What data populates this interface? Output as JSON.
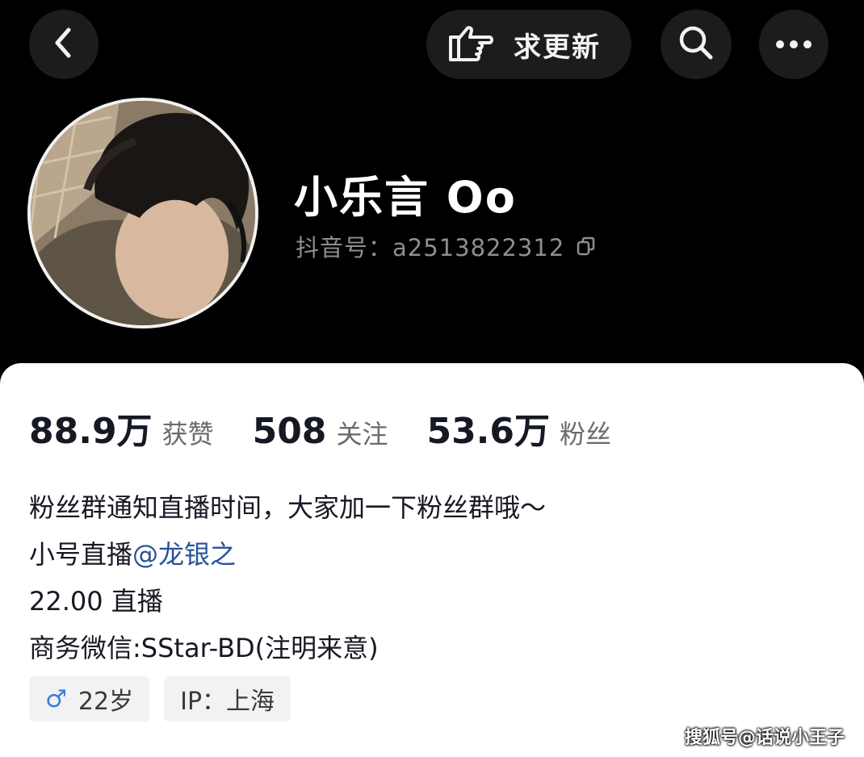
{
  "header": {
    "update_label": "求更新",
    "icons": [
      "back-icon",
      "pointing-hand-icon",
      "search-icon",
      "more-icon"
    ]
  },
  "profile": {
    "nickname": "小乐言 Oo",
    "account_id": "抖音号：a2513822312"
  },
  "stats": [
    {
      "value": "88.9万",
      "label": "获赞"
    },
    {
      "value": "508",
      "label": "关注"
    },
    {
      "value": "53.6万",
      "label": "粉丝"
    }
  ],
  "bio": {
    "line1": "粉丝群通知直播时间，大家加一下粉丝群哦～",
    "line2_prefix": "小号直播",
    "line2_mention": "@龙银之",
    "line3": "22.00 直播",
    "line4": "商务微信:SStar-BD(注明来意)"
  },
  "tags": {
    "gender_symbol": "♂",
    "age": "22岁",
    "ip": "IP：上海"
  },
  "watermark": "搜狐号@话说小王子",
  "colors": {
    "background": "#000000",
    "card": "#ffffff",
    "mention": "#28539a",
    "gender": "#3a7fd5"
  }
}
